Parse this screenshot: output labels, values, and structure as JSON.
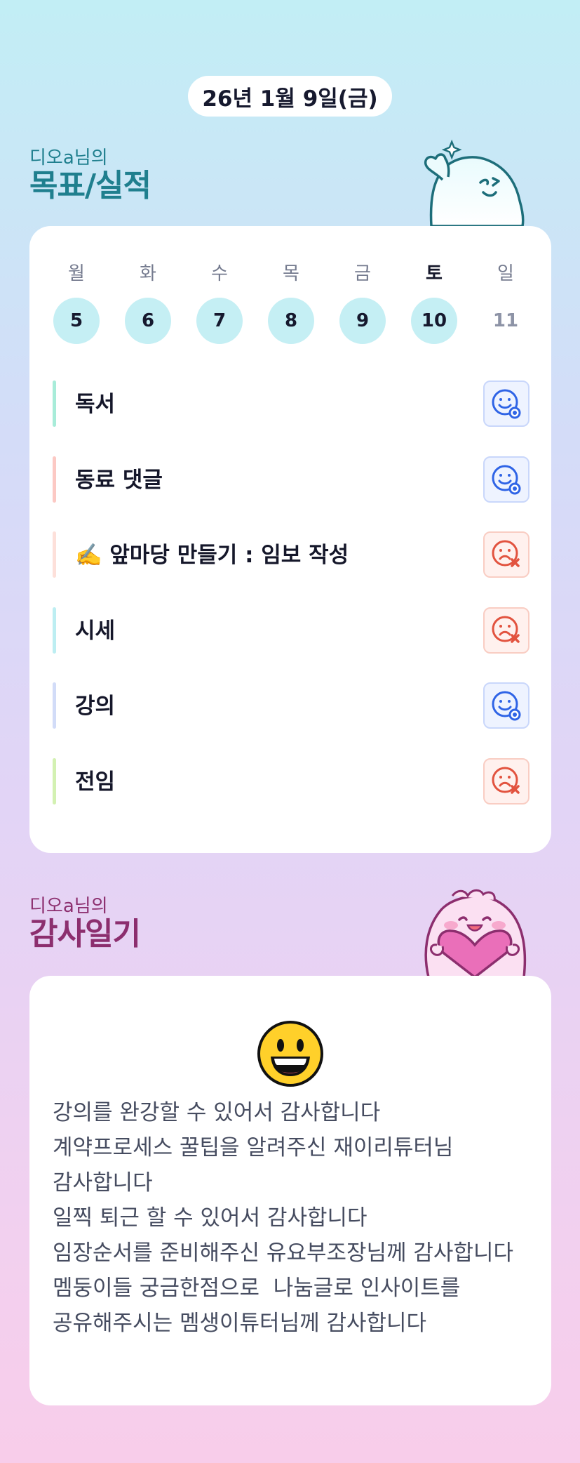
{
  "date": "26년 1월 9일(금)",
  "goals_section": {
    "owner": "디오a님의",
    "title": "목표/실적"
  },
  "week": [
    {
      "label": "월",
      "day": "5",
      "filled": true,
      "today": false
    },
    {
      "label": "화",
      "day": "6",
      "filled": true,
      "today": false
    },
    {
      "label": "수",
      "day": "7",
      "filled": true,
      "today": false
    },
    {
      "label": "목",
      "day": "8",
      "filled": true,
      "today": false
    },
    {
      "label": "금",
      "day": "9",
      "filled": true,
      "today": false
    },
    {
      "label": "토",
      "day": "10",
      "filled": true,
      "today": true
    },
    {
      "label": "일",
      "day": "11",
      "filled": false,
      "today": false
    }
  ],
  "goals": [
    {
      "text": "독서",
      "bar_color": "#a8ecd9",
      "status": "good",
      "status_icon": "smile-check-icon"
    },
    {
      "text": "동료 댓글",
      "bar_color": "#fcc9c4",
      "status": "good",
      "status_icon": "smile-check-icon"
    },
    {
      "text": "✍️ 앞마당 만들기 : 임보 작성",
      "bar_color": "#fde0da",
      "status": "bad",
      "status_icon": "sad-x-icon"
    },
    {
      "text": "시세",
      "bar_color": "#bdeef2",
      "status": "bad",
      "status_icon": "sad-x-icon"
    },
    {
      "text": "강의",
      "bar_color": "#d2dcf8",
      "status": "good",
      "status_icon": "smile-check-icon"
    },
    {
      "text": "전임",
      "bar_color": "#d3f1b2",
      "status": "bad",
      "status_icon": "sad-x-icon"
    }
  ],
  "gratitude_section": {
    "owner": "디오a님의",
    "title": "감사일기"
  },
  "gratitude": {
    "emoji_icon": "grinning-face-icon",
    "text": "강의를 완강할 수 있어서 감사합니다\n계약프로세스 꿀팁을 알려주신 재이리튜터님 감사합니다\n일찍 퇴근 할 수 있어서 감사합니다\n임장순서를 준비해주신 유요부조장님께 감사합니다\n멤둥이들 궁금한점으로  나눔글로 인사이트를 공유해주시는 멤생이튜터님께 감사합니다"
  },
  "colors": {
    "good": "#2f64e6",
    "bad": "#e2533f",
    "goals_title": "#1f7f8e",
    "grat_title": "#8c2e6e"
  }
}
